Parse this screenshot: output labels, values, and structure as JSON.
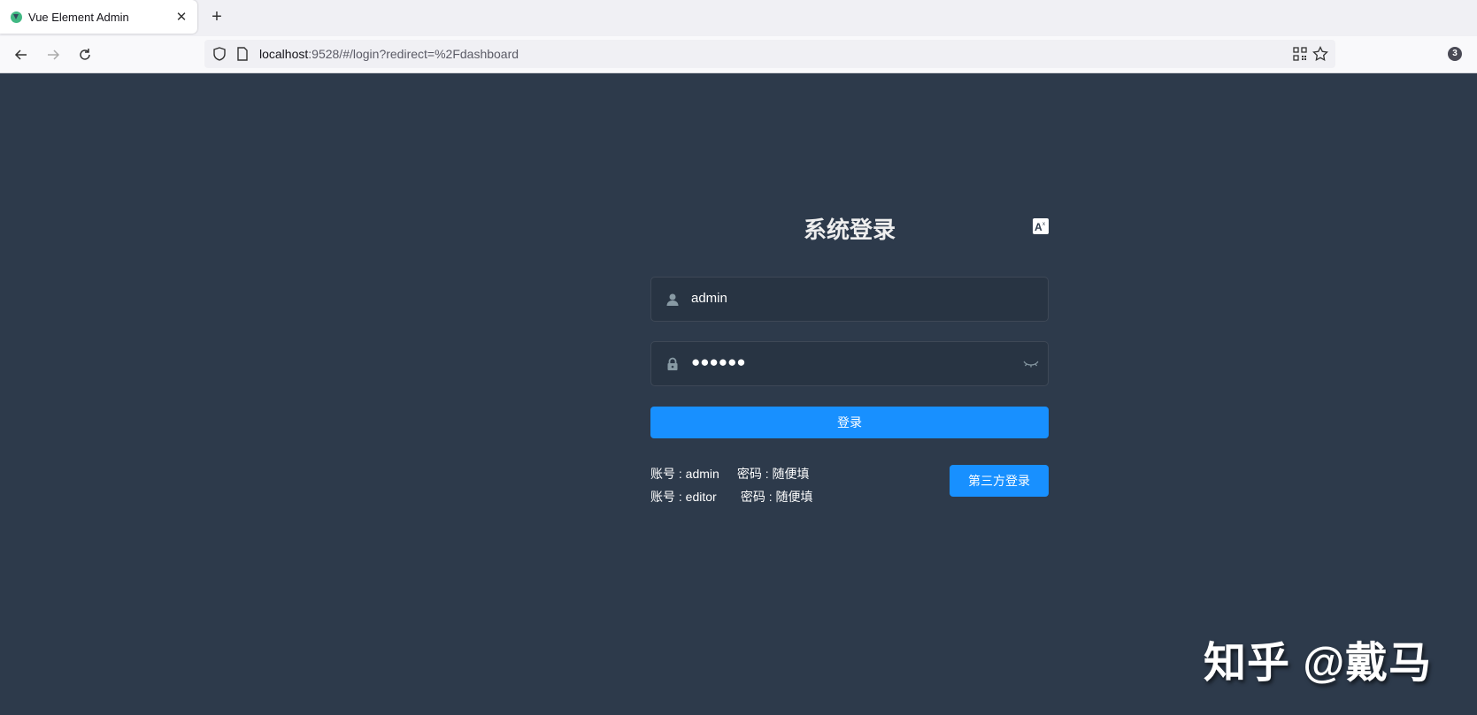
{
  "browser": {
    "tab_title": "Vue Element Admin",
    "new_tab_symbol": "+",
    "close_symbol": "✕",
    "url_host": "localhost",
    "url_rest": ":9528/#/login?redirect=%2Fdashboard",
    "extension_badge_count": "3",
    "icons": [
      "back-icon",
      "forward-icon",
      "reload-icon",
      "shield-icon",
      "page-icon",
      "qr-code-icon",
      "star-icon"
    ]
  },
  "login": {
    "title": "系统登录",
    "username_value": "admin",
    "password_mask": "●●●●●●",
    "login_button": "登录",
    "tips": [
      {
        "account": "账号 : admin",
        "password": "密码 : 随便填"
      },
      {
        "account": "账号 : editor",
        "password": "密码 : 随便填"
      }
    ],
    "third_party_button": "第三方登录"
  },
  "watermark": "知乎 @戴马",
  "colors": {
    "background": "#2d3a4b",
    "primary": "#1890ff",
    "title": "#eeeeee"
  }
}
